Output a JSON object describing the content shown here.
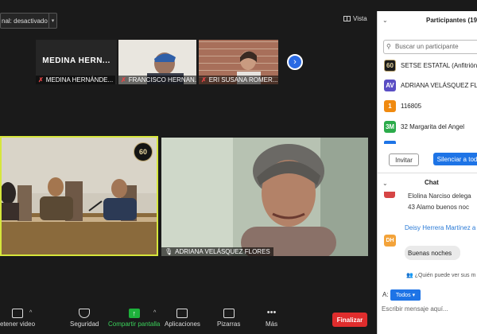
{
  "top": {
    "dropdown_text": "nal: desactivado",
    "view_label": "Vista"
  },
  "strip": {
    "tiles": [
      {
        "display_name": "MEDINA  HERN...",
        "label": "MEDINA HERNÁNDE..."
      },
      {
        "label": "FRANCISCO HERNAN..."
      },
      {
        "label": "ERI SUSANA ROMER..."
      }
    ]
  },
  "main": {
    "left_tile_label": "",
    "left_logo": "60",
    "right_tile_label": "ADRIANA VELÁSQUEZ FLORES"
  },
  "toolbar": {
    "video_label": "etener video",
    "security_label": "Seguridad",
    "share_label": "Compartir pantalla",
    "apps_label": "Aplicaciones",
    "whiteboard_label": "Pizarras",
    "more_label": "Más",
    "end_label": "Finalizar"
  },
  "participants": {
    "title": "Participantes (19",
    "search_placeholder": "Buscar un participante",
    "rows": [
      {
        "avatar_text": "60",
        "name": "SETSE ESTATAL (Anfitrión,",
        "color": "#1b1b1b"
      },
      {
        "avatar_text": "AV",
        "name": "ADRIANA VELÁSQUEZ FLO",
        "color": "#5a4ec4"
      },
      {
        "avatar_text": "1",
        "name": "116805",
        "color": "#f08a10"
      },
      {
        "avatar_text": "3M",
        "name": "32 Margarita del Angel",
        "color": "#2bab4a"
      }
    ],
    "invite_label": "Invitar",
    "mute_all_label": "Silenciar a tod"
  },
  "chat": {
    "title": "Chat",
    "messages": [
      {
        "text": "Elolina Narciso delega"
      },
      {
        "text": "43 Alamo buenos noc"
      }
    ],
    "sender": "Deisy Herrera Martínez a",
    "sender_avatar": "DH",
    "bubble_text": "Buenas noches",
    "who_can_see": "¿Quién puede ver sus m",
    "to_label": "A:",
    "to_value": "Todos",
    "input_placeholder": "Escribir mensaje aquí..."
  },
  "colors": {
    "accent": "#1e74e6",
    "share_green": "#1db13b",
    "end_red": "#df2d2d",
    "active_speaker": "#d6e63c"
  }
}
